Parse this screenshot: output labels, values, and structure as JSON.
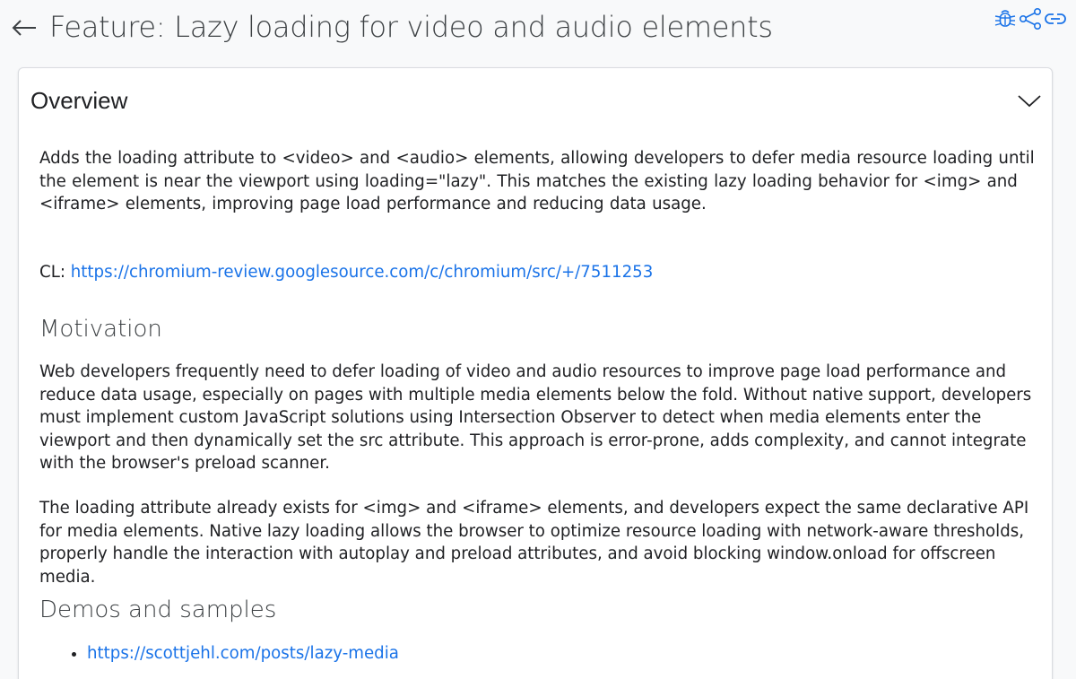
{
  "header": {
    "title": "Feature: Lazy loading for video and audio elements",
    "icons": [
      "back-arrow-icon",
      "bug-icon",
      "share-icon",
      "link-icon"
    ]
  },
  "overview": {
    "title": "Overview",
    "description": "Adds the loading attribute to <video> and <audio> elements, allowing developers to defer media resource loading until the element is near the viewport using loading=\"lazy\". This matches the existing lazy loading behavior for <img> and <iframe> elements, improving page load performance and reducing data usage.",
    "cl_label": "CL:",
    "cl_url": "https://chromium-review.googlesource.com/c/chromium/src/+/7511253"
  },
  "motivation": {
    "heading": "Motivation",
    "paragraphs": [
      "Web developers frequently need to defer loading of video and audio resources to improve page load performance and reduce data usage, especially on pages with multiple media elements below the fold. Without native support, developers must implement custom JavaScript solutions using Intersection Observer to detect when media elements enter the viewport and then dynamically set the src attribute. This approach is error-prone, adds complexity, and cannot integrate with the browser's preload scanner.",
      "The loading attribute already exists for <img> and <iframe> elements, and developers expect the same declarative API for media elements. Native lazy loading allows the browser to optimize resource loading with network-aware thresholds, properly handle the interaction with autoplay and preload attributes, and avoid blocking window.onload for offscreen media."
    ]
  },
  "demos": {
    "heading": "Demos and samples",
    "links": [
      "https://scottjehl.com/posts/lazy-media"
    ]
  },
  "colors": {
    "link": "#1a73e8",
    "text": "#202124",
    "heading": "#3c4043",
    "icon": "#1a73e8"
  }
}
